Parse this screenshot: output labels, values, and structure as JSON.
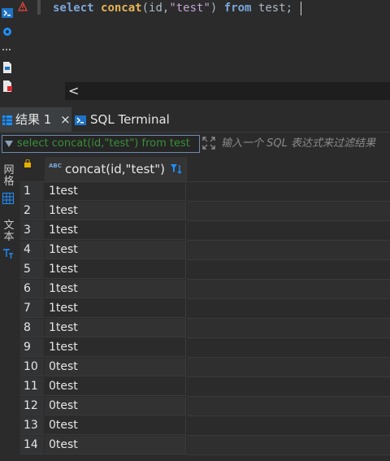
{
  "editor": {
    "code_tokens": {
      "kw1": "select",
      "fn": "concat",
      "open": "(id,",
      "str": "\"test\"",
      "close": ")",
      "kw2": "from",
      "table": "test;"
    },
    "scroll_left": "<"
  },
  "tabs": {
    "results": "结果 1",
    "results_close": "×",
    "terminal": "SQL Terminal"
  },
  "filter": {
    "value": "select concat(id,\"test\") from test",
    "hint": "输入一个 SQL 表达式来过滤结果"
  },
  "side_panel": {
    "grid_label": "网格",
    "text_label": "文本"
  },
  "grid": {
    "column_header": "concat(id,\"test\")",
    "type_badge": "ABC",
    "rows": [
      {
        "num": "1",
        "value": "1test"
      },
      {
        "num": "2",
        "value": "1test"
      },
      {
        "num": "3",
        "value": "1test"
      },
      {
        "num": "4",
        "value": "1test"
      },
      {
        "num": "5",
        "value": "1test"
      },
      {
        "num": "6",
        "value": "1test"
      },
      {
        "num": "7",
        "value": "1test"
      },
      {
        "num": "8",
        "value": "1test"
      },
      {
        "num": "9",
        "value": "1test"
      },
      {
        "num": "10",
        "value": "0test"
      },
      {
        "num": "11",
        "value": "0test"
      },
      {
        "num": "12",
        "value": "0test"
      },
      {
        "num": "13",
        "value": "0test"
      },
      {
        "num": "14",
        "value": "0test"
      }
    ]
  },
  "colors": {
    "keyword": "#7aa6da",
    "function": "#e6b455",
    "string": "#c7a2d4",
    "filter_text": "#3a8f3a",
    "accent": "#1e90ff"
  }
}
